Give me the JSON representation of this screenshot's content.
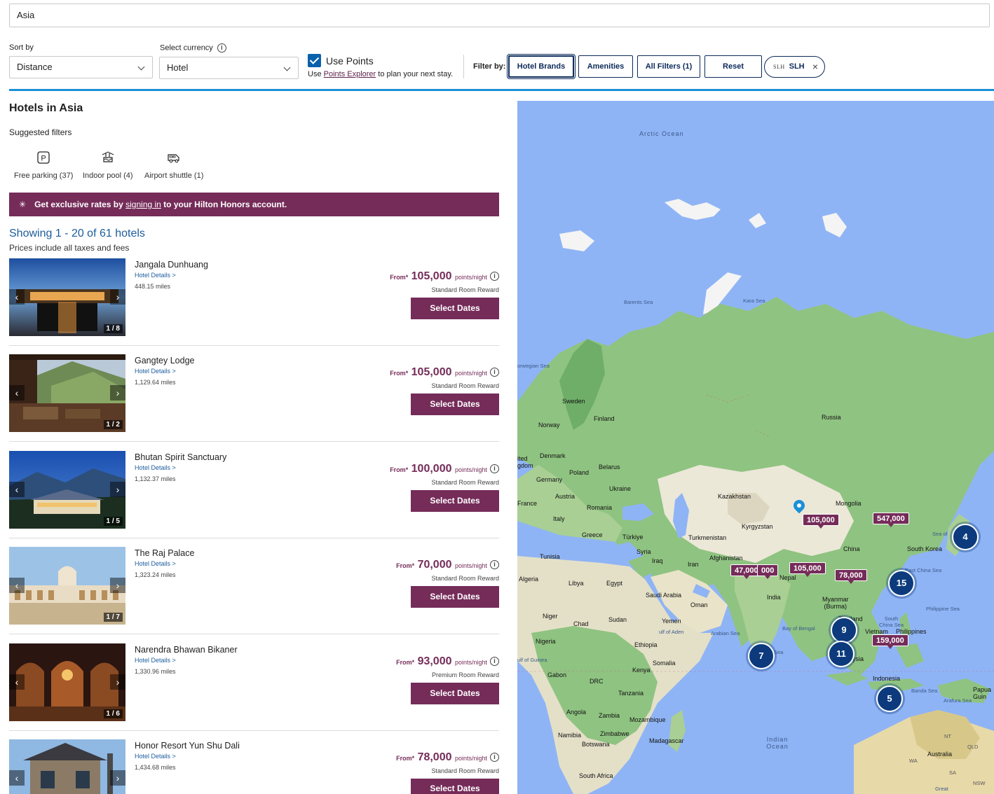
{
  "search": {
    "value": "Asia"
  },
  "sort": {
    "label": "Sort by",
    "value": "Distance"
  },
  "currency": {
    "label": "Select currency",
    "value": "Hotel"
  },
  "use_points": {
    "label": "Use Points",
    "note_pre": "Use ",
    "note_link": "Points Explorer",
    "note_post": " to plan your next stay.",
    "checked": true
  },
  "filters": {
    "label": "Filter by:",
    "buttons": [
      "Hotel Brands",
      "Amenities",
      "All Filters (1)",
      "Reset"
    ],
    "chip_logo": "SLH",
    "chip_text": "SLH",
    "chip_close": "×"
  },
  "page_title": "Hotels in Asia",
  "suggested": {
    "title": "Suggested filters",
    "items": [
      "Free parking (37)",
      "Indoor pool (4)",
      "Airport shuttle (1)"
    ]
  },
  "banner": {
    "pre": "Get exclusive rates by ",
    "link": "signing in",
    "post": " to your Hilton Honors account."
  },
  "results": {
    "showing": "Showing 1 - 20 of 61 hotels",
    "note": "Prices include all taxes and fees"
  },
  "hotels": [
    {
      "name": "Jangala Dunhuang",
      "details": "Hotel Details >",
      "miles": "448.15 miles",
      "from": "From*",
      "points": "105,000",
      "per": "points/night",
      "room": "Standard Room Reward",
      "cta": "Select Dates",
      "photo": "1 / 8"
    },
    {
      "name": "Gangtey Lodge",
      "details": "Hotel Details >",
      "miles": "1,129.64 miles",
      "from": "From*",
      "points": "105,000",
      "per": "points/night",
      "room": "Standard Room Reward",
      "cta": "Select Dates",
      "photo": "1 / 2"
    },
    {
      "name": "Bhutan Spirit Sanctuary",
      "details": "Hotel Details >",
      "miles": "1,132.37 miles",
      "from": "From*",
      "points": "100,000",
      "per": "points/night",
      "room": "Standard Room Reward",
      "cta": "Select Dates",
      "photo": "1 / 5"
    },
    {
      "name": "The Raj Palace",
      "details": "Hotel Details >",
      "miles": "1,323.24 miles",
      "from": "From*",
      "points": "70,000",
      "per": "points/night",
      "room": "Standard Room Reward",
      "cta": "Select Dates",
      "photo": "1 / 7"
    },
    {
      "name": "Narendra Bhawan Bikaner",
      "details": "Hotel Details >",
      "miles": "1,330.96 miles",
      "from": "From*",
      "points": "93,000",
      "per": "points/night",
      "room": "Premium Room Reward",
      "cta": "Select Dates",
      "photo": "1 / 6"
    },
    {
      "name": "Honor Resort Yun Shu Dali",
      "details": "Hotel Details >",
      "miles": "1,434.68 miles",
      "from": "From*",
      "points": "78,000",
      "per": "points/night",
      "room": "Standard Room Reward",
      "cta": "Select Dates",
      "photo": ""
    }
  ],
  "map": {
    "labels": {
      "arctic": "Arctic Ocean",
      "indian": "Indian Ocean",
      "barents": "Barents Sea",
      "kara": "Kara Sea",
      "norwegian": "orwegian Sea",
      "russia": "Russia",
      "sweden": "Sweden",
      "finland": "Finland",
      "norway": "Norway",
      "denmark": "Denmark",
      "kingdom": "ited\ngdom",
      "germany": "Germany",
      "poland": "Poland",
      "belarus": "Belarus",
      "ukraine": "Ukraine",
      "france": "France",
      "austria": "Austria",
      "romania": "Romania",
      "italy": "Italy",
      "greece": "Greece",
      "turkiye": "Türkiye",
      "kazakhstan": "Kazakhstan",
      "mongolia": "Mongolia",
      "kyrgyzstan": "Kyrgyzstan",
      "turkmenistan": "Turkmenistan",
      "afghanistan": "Afghanistan",
      "china": "China",
      "southkorea": "South Korea",
      "tunisia": "Tunisia",
      "syria": "Syria",
      "iraq": "Iraq",
      "iran": "Iran",
      "algeria": "Algeria",
      "libya": "Libya",
      "egypt": "Egypt",
      "nepal": "Nepal",
      "india": "India",
      "saudi": "Saudi Arabia",
      "oman": "Oman",
      "myanmar": "Myanmar\n(Burma)",
      "thailand": "Thailand",
      "vietnam": "Vietnam",
      "philippines": "Philippines",
      "niger": "Niger",
      "chad": "Chad",
      "sudan": "Sudan",
      "yemen": "Yemen",
      "nigeria": "Nigeria",
      "ethiopia": "Ethiopia",
      "somalia": "Somalia",
      "kenya": "Kenya",
      "gabon": "Gabon",
      "drc": "DRC",
      "tanzania": "Tanzania",
      "angola": "Angola",
      "zambia": "Zambia",
      "mozambique": "Mozambique",
      "namibia": "Namibia",
      "zimbabwe": "Zimbabwe",
      "botswana": "Botswana",
      "madagascar": "Madagascar",
      "southafrica": "South Africa",
      "indonesia": "Indonesia",
      "australia": "Australia",
      "papua": "Papua\nGuin",
      "malaysia": "ysia",
      "arabian": "Arabian Sea",
      "bengal": "Bay of Bengal",
      "eastchina": "East China Sea",
      "southchina": "South\nChina Sea",
      "philsea": "Philippine Sea",
      "banda": "Banda Sea",
      "arafura": "Arafura Sea",
      "aden": "ulf of Aden",
      "guinea": "ulf of Guinea",
      "seaof": "Sea of",
      "nt": "NT",
      "qld": "QLD",
      "wa": "WA",
      "sa": "SA",
      "nsw": "NSW",
      "great": "Great",
      "sea": "Sea"
    },
    "pins": [
      "105,000",
      "547,000",
      "47,000",
      "000",
      "105,000",
      "78,000",
      "159,000"
    ],
    "clusters": [
      "4",
      "15",
      "9",
      "11",
      "7",
      "5"
    ]
  }
}
